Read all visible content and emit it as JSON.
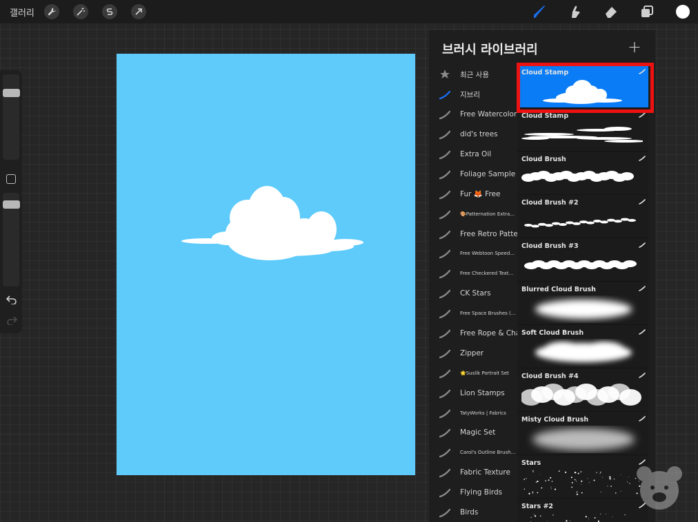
{
  "topbar": {
    "gallery": "갤러리"
  },
  "library": {
    "title": "브러시 라이브러리",
    "add": "+",
    "sets": [
      {
        "label": "최근 사용",
        "icon": "star-icon",
        "small": false
      },
      {
        "label": "지브리",
        "icon": "brush-stroke-icon-active",
        "small": false
      },
      {
        "label": "Free Watercolor",
        "icon": "brush-stroke-icon",
        "small": false
      },
      {
        "label": "did's trees",
        "icon": "brush-stroke-icon",
        "small": false
      },
      {
        "label": "Extra Oil",
        "icon": "brush-stroke-icon",
        "small": false
      },
      {
        "label": "Foliage Sample",
        "icon": "brush-stroke-icon",
        "small": false
      },
      {
        "label": "Fur 🦊 Free",
        "icon": "brush-stroke-icon",
        "small": false
      },
      {
        "label": "🎨Patternation Extra...",
        "icon": "brush-stroke-icon",
        "small": true
      },
      {
        "label": "Free Retro Pattern",
        "icon": "brush-stroke-icon",
        "small": false
      },
      {
        "label": "Free Webtoon Speed...",
        "icon": "brush-stroke-icon",
        "small": true
      },
      {
        "label": "Free Checkered Text...",
        "icon": "brush-stroke-icon",
        "small": true
      },
      {
        "label": "CK Stars",
        "icon": "brush-stroke-icon",
        "small": false
      },
      {
        "label": "Free Space Brushes (...",
        "icon": "brush-stroke-icon",
        "small": true
      },
      {
        "label": "Free Rope & Chain",
        "icon": "brush-stroke-icon",
        "small": false
      },
      {
        "label": "Zipper",
        "icon": "brush-stroke-icon",
        "small": false
      },
      {
        "label": "🌟Suslik Portrait Set",
        "icon": "brush-stroke-icon",
        "small": true
      },
      {
        "label": "Lion Stamps",
        "icon": "brush-stroke-icon",
        "small": false
      },
      {
        "label": "TatyWorks | Fabrics",
        "icon": "brush-stroke-icon",
        "small": true
      },
      {
        "label": "Magic Set",
        "icon": "brush-stroke-icon",
        "small": false
      },
      {
        "label": "Carol's Outline Brush...",
        "icon": "brush-stroke-icon",
        "small": true
      },
      {
        "label": "Fabric Texture",
        "icon": "brush-stroke-icon",
        "small": false
      },
      {
        "label": "Flying Birds",
        "icon": "brush-stroke-icon",
        "small": false
      },
      {
        "label": "Birds",
        "icon": "brush-stroke-icon",
        "small": false
      }
    ],
    "brushes": [
      {
        "name": "Cloud Stamp",
        "preview": "cloud-stamp",
        "selected": true
      },
      {
        "name": "Cloud Stamp",
        "preview": "cloud-streaks",
        "selected": false
      },
      {
        "name": "Cloud Brush",
        "preview": "cloud-band",
        "selected": false
      },
      {
        "name": "Cloud Brush #2",
        "preview": "cloud-thin",
        "selected": false
      },
      {
        "name": "Cloud Brush #3",
        "preview": "cloud-band2",
        "selected": false
      },
      {
        "name": "Blurred Cloud Brush",
        "preview": "cloud-blur",
        "selected": false
      },
      {
        "name": "Soft Cloud Brush",
        "preview": "cloud-soft",
        "selected": false
      },
      {
        "name": "Cloud Brush #4",
        "preview": "cloud-puffs",
        "selected": false
      },
      {
        "name": "Misty Cloud Brush",
        "preview": "cloud-mist",
        "selected": false
      },
      {
        "name": "Stars",
        "preview": "stars",
        "selected": false
      },
      {
        "name": "Stars #2",
        "preview": "stars2",
        "selected": false
      }
    ]
  },
  "colors": {
    "canvas": "#5ecbfb",
    "selected_brush": "#0a7cf5",
    "highlight": "#ee1111",
    "active_tool": "#1a6df0"
  }
}
